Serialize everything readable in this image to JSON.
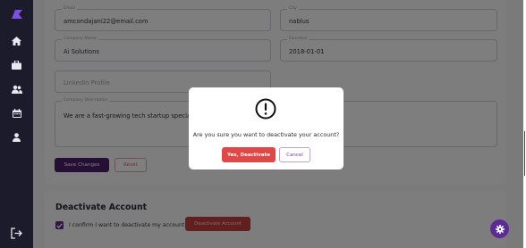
{
  "sidebar": {
    "logo_icon": "app-logo",
    "items": [
      {
        "icon": "home-icon"
      },
      {
        "icon": "briefcase-icon"
      },
      {
        "icon": "users-icon"
      },
      {
        "icon": "calendar-icon"
      },
      {
        "icon": "user-icon"
      }
    ],
    "logout_icon": "logout-icon"
  },
  "form": {
    "email": {
      "label": "Email",
      "value": "amcondajani22@email.com"
    },
    "city": {
      "label": "City",
      "value": "nablus"
    },
    "company_name": {
      "label": "Company Name",
      "value": "Ai Solutions"
    },
    "founded": {
      "label": "Founded",
      "value": "2018-01-01"
    },
    "linkedin": {
      "placeholder": "LinkedIn Profile"
    },
    "description": {
      "label": "Company Description",
      "value": "We are a fast-growing tech startup specializing"
    },
    "save_label": "Save Changes",
    "reset_label": "Reset"
  },
  "deactivate": {
    "title": "Deactivate Account",
    "confirm_label": "I confirm I want to deactivate my account",
    "checked": true,
    "button_label": "Deactivate Account"
  },
  "dialog": {
    "icon": "exclamation-circle-icon",
    "message": "Are you sure you want to deactivate your account?",
    "confirm_label": "Yes, Deactivate",
    "cancel_label": "Cancel"
  },
  "fab": {
    "icon": "gear-icon"
  },
  "colors": {
    "sidebar_bg": "#1c1b2c",
    "primary": "#4d1f6b",
    "danger": "#e04848",
    "fab": "#5b2d94"
  }
}
